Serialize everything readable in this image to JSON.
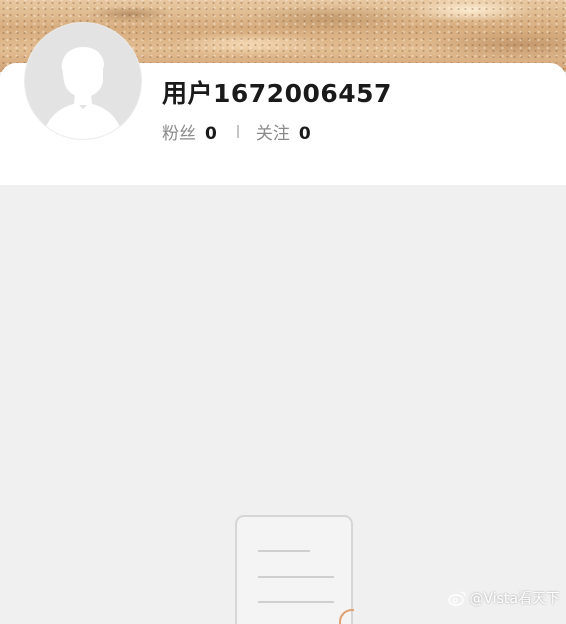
{
  "profile": {
    "username": "用户1672006457",
    "followers_label": "粉丝",
    "followers_count": "0",
    "following_label": "关注",
    "following_count": "0"
  },
  "watermark": {
    "text": "@Vista看天下"
  },
  "icons": {
    "avatar": "default-person-avatar",
    "empty_state": "document-icon",
    "watermark": "weibo-icon"
  },
  "colors": {
    "background": "#f0f0f0",
    "card": "#ffffff",
    "username": "#1a1a1a",
    "secondary_text": "#8a8a8a"
  }
}
